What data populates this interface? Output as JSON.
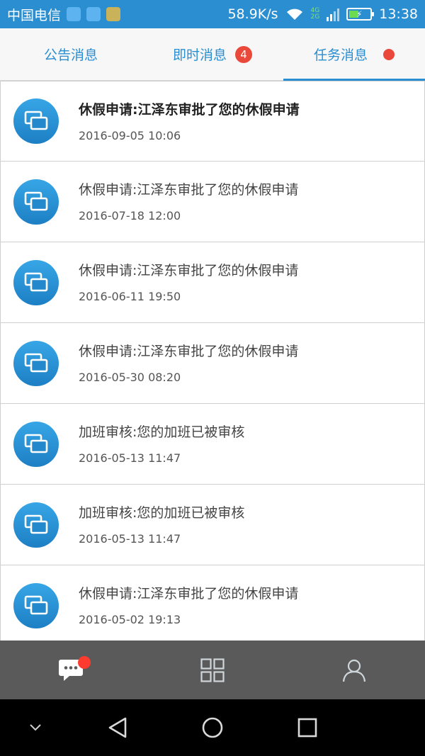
{
  "status_bar": {
    "carrier": "中国电信",
    "speed": "58.9K/s",
    "network_label_top": "4G",
    "network_label_bottom": "2G",
    "time": "13:38"
  },
  "tabs": [
    {
      "label": "公告消息"
    },
    {
      "label": "即时消息",
      "badge": "4"
    },
    {
      "label": "任务消息"
    }
  ],
  "messages": [
    {
      "title": "休假申请:江泽东审批了您的休假申请",
      "time": "2016-09-05 10:06"
    },
    {
      "title": "休假申请:江泽东审批了您的休假申请",
      "time": "2016-07-18 12:00"
    },
    {
      "title": "休假申请:江泽东审批了您的休假申请",
      "time": "2016-06-11 19:50"
    },
    {
      "title": "休假申请:江泽东审批了您的休假申请",
      "time": "2016-05-30 08:20"
    },
    {
      "title": "加班审核:您的加班已被审核",
      "time": "2016-05-13 11:47"
    },
    {
      "title": "加班审核:您的加班已被审核",
      "time": "2016-05-13 11:47"
    },
    {
      "title": "休假申请:江泽东审批了您的休假申请",
      "time": "2016-05-02 19:13"
    }
  ],
  "bottom_nav": {
    "items": [
      {
        "icon": "chat-icon"
      },
      {
        "icon": "grid-icon"
      },
      {
        "icon": "user-icon"
      }
    ]
  },
  "colors": {
    "brand": "#2a8ed1",
    "badge": "#e9483a",
    "nav_bg": "#5a5a5a"
  }
}
